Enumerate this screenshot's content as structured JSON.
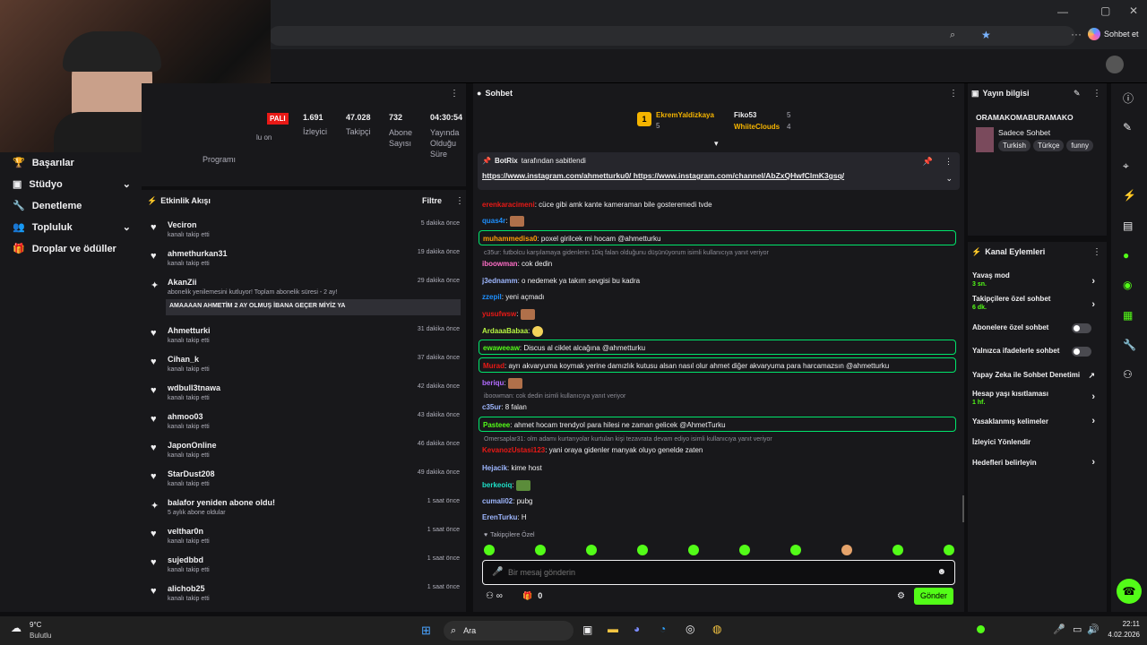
{
  "browser": {
    "chat_label": "Sohbet et"
  },
  "sidebar": {
    "items": [
      {
        "label": "Başarılar"
      },
      {
        "label": "Stüdyo"
      },
      {
        "label": "Denetleme"
      },
      {
        "label": "Topluluk"
      },
      {
        "label": "Droplar ve ödüller"
      }
    ]
  },
  "stats": {
    "live_badge": "PALI",
    "partial_text": "lu on",
    "program_label": "Programı",
    "items": [
      {
        "value": "1.691",
        "label": "İzleyici"
      },
      {
        "value": "47.028",
        "label": "Takipçi"
      },
      {
        "value": "732",
        "label": "Abone Sayısı"
      },
      {
        "value": "04:30:54",
        "label": "Yayında Olduğu Süre"
      }
    ]
  },
  "activity": {
    "title": "Etkinlik Akışı",
    "filter": "Filtre",
    "items": [
      {
        "name": "Veciron",
        "sub": "kanalı takip etti",
        "time": "5 dakika önce"
      },
      {
        "name": "ahmethurkan31",
        "sub": "kanalı takip etti",
        "time": "19 dakika önce"
      },
      {
        "name": "AkanZii",
        "sub": "abonelik yenilemesini kutluyor! Toplam abonelik süresi - 2 ay!",
        "time": "29 dakika önce",
        "message": "AMAAAAN AHMETİM 2 AY OLMUŞ İBANA GEÇER MİYİZ YA"
      },
      {
        "name": "Ahmetturki",
        "sub": "kanalı takip etti",
        "time": "31 dakika önce"
      },
      {
        "name": "Cihan_k",
        "sub": "kanalı takip etti",
        "time": "37 dakika önce"
      },
      {
        "name": "wdbull3tnawa",
        "sub": "kanalı takip etti",
        "time": "42 dakika önce"
      },
      {
        "name": "ahmoo03",
        "sub": "kanalı takip etti",
        "time": "43 dakika önce"
      },
      {
        "name": "JaponOnline",
        "sub": "kanalı takip etti",
        "time": "46 dakika önce"
      },
      {
        "name": "StarDust208",
        "sub": "kanalı takip etti",
        "time": "49 dakika önce"
      },
      {
        "name": "balafor yeniden abone oldu!",
        "sub": "5 aylık abone oldular",
        "time": "1 saat önce"
      },
      {
        "name": "velthar0n",
        "sub": "kanalı takip etti",
        "time": "1 saat önce"
      },
      {
        "name": "sujedbbd",
        "sub": "kanalı takip etti",
        "time": "1 saat önce"
      },
      {
        "name": "alichob25",
        "sub": "kanalı takip etti",
        "time": "1 saat önce"
      }
    ]
  },
  "chat": {
    "title": "Sohbet",
    "top": [
      {
        "name": "EkremYaldizkaya",
        "count": "5"
      },
      {
        "name": "Fiko53",
        "count": "5"
      },
      {
        "name": "WhiiteClouds",
        "count": "4"
      }
    ],
    "pinned": {
      "by": "BotRix",
      "suffix": "tarafından sabitlendi",
      "text": "https://www.instagram.com/ahmetturku0/ https://www.instagram.com/channel/AbZxQHwfClmK3gsq/"
    },
    "messages": [
      {
        "user": "erenkaracimeni",
        "color": "#e91916",
        "text": ": cüce gibi amk kante kameraman bile gosteremedi tvde"
      },
      {
        "user": "quas4r",
        "color": "#1e90ff",
        "text": ":"
      },
      {
        "user": "muhammedisa0",
        "color": "#ff9f0a",
        "text": ": poxel girilcek mi hocam @ahmetturku",
        "hl": true
      },
      {
        "reply": "c35ur: futbolcu karşılamaya gidenlerin 10iq falan olduğunu düşünüyorum isimli kullanıcıya yanıt veriyor"
      },
      {
        "user": "iboowman",
        "color": "#ff6ec7",
        "text": ": cok dedin"
      },
      {
        "user": "j3ednamm",
        "color": "#9eb7ff",
        "text": ": o nedemek ya takım sevgisi bu kadra"
      },
      {
        "user": "zzepil",
        "color": "#1e90ff",
        "text": ": yeni açmadı"
      },
      {
        "user": "yusufwsw",
        "color": "#e91916",
        "text": ":"
      },
      {
        "user": "ArdaaaBabaa",
        "color": "#b7f542",
        "text": ":"
      },
      {
        "user": "ewaweeaw",
        "color": "#53fc18",
        "text": ": Discus al ciklet alcağına @ahmetturku",
        "hl": true
      },
      {
        "user": "Murad",
        "color": "#e91916",
        "text": ": ayrı akvaryuma koymak yerine damızlık kutusu alsan nasıl olur ahmet diğer akvaryuma para harcamazsın @ahmetturku",
        "hl": true
      },
      {
        "user": "beriqu",
        "color": "#b26bff",
        "text": ":"
      },
      {
        "reply": "iboowman: cok dedin isimli kullanıcıya yanıt veriyor"
      },
      {
        "user": "c35ur",
        "color": "#9eb7ff",
        "text": ": 8 falan"
      },
      {
        "user": "Pasteee",
        "color": "#53fc18",
        "text": ": ahmet hocam trendyol para hilesi ne zaman gelicek @AhmetTurku",
        "hl": true
      },
      {
        "reply": "Omersaplar31: olm adamı kurtarıyolar kurtulan kişi tezavrata devam ediyo isimli kullanıcıya yanıt veriyor"
      },
      {
        "user": "KevanozUstasi123",
        "color": "#e91916",
        "text": ": yani oraya gidenler manyak oluyo genelde zaten"
      },
      {
        "user": "Hejacik",
        "color": "#9eb7ff",
        "text": ": kime host"
      },
      {
        "user": "berkeoiq",
        "color": "#1ee0c8",
        "text": ":"
      },
      {
        "user": "cumali02",
        "color": "#9eb7ff",
        "text": ": pubg"
      },
      {
        "user": "ErenTurku",
        "color": "#9eb7ff",
        "text": ": H"
      }
    ],
    "followers_only": "Takipçilere Özel",
    "input_placeholder": "Bir mesaj gönderin",
    "points": "0",
    "send": "Gönder"
  },
  "info": {
    "title": "Yayın bilgisi",
    "channel": "ORAMAKOMABURAMAKO",
    "stream_title": "Sadece Sohbet",
    "tags": [
      "Turkish",
      "Türkçe",
      "funny"
    ]
  },
  "actions": {
    "title": "Kanal Eylemleri",
    "items": [
      {
        "label": "Yavaş mod",
        "sub": "3 sn.",
        "kind": "chev"
      },
      {
        "label": "Takipçilere özel sohbet",
        "sub": "6 dk.",
        "kind": "chev"
      },
      {
        "label": "Abonelere özel sohbet",
        "sub": "",
        "kind": "toggle"
      },
      {
        "label": "Yalnızca ifadelerle sohbet",
        "sub": "",
        "kind": "toggle"
      },
      {
        "label": "Yapay Zeka ile Sohbet Denetimi",
        "sub": "",
        "kind": "ext"
      },
      {
        "label": "Hesap yaşı kısıtlaması",
        "sub": "1 hf.",
        "kind": "chev"
      },
      {
        "label": "Yasaklanmış kelimeler",
        "sub": "",
        "kind": "chev"
      },
      {
        "label": "İzleyici Yönlendir",
        "sub": "",
        "kind": "none"
      },
      {
        "label": "Hedefleri belirleyin",
        "sub": "",
        "kind": "chev"
      }
    ]
  },
  "taskbar": {
    "weather_temp": "9°C",
    "weather_desc": "Bulutlu",
    "search": "Ara",
    "time": "22:11",
    "date": "4.02.2026"
  },
  "colors": {
    "accent": "#53fc18",
    "bg": "#0e0e10",
    "panel": "#18181b"
  }
}
